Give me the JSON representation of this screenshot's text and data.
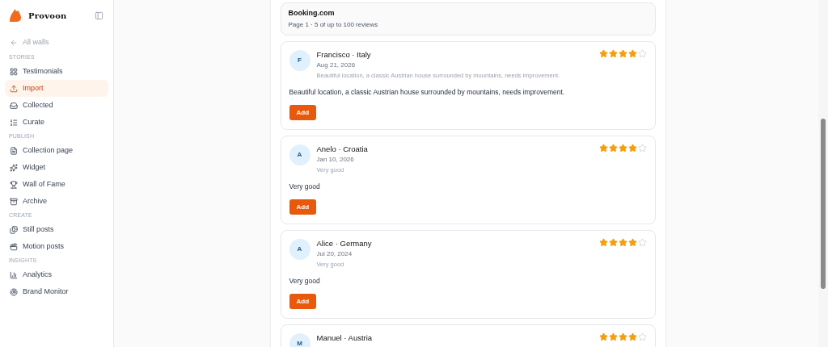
{
  "sidebar": {
    "brand": "Provoon",
    "back_link": "All walls",
    "sections": [
      {
        "title": "STORIES",
        "items": [
          {
            "label": "Testimonials",
            "selected": false
          },
          {
            "label": "Import",
            "selected": true
          },
          {
            "label": "Collected",
            "selected": false
          },
          {
            "label": "Curate",
            "selected": false
          }
        ]
      },
      {
        "title": "PUBLISH",
        "items": [
          {
            "label": "Collection page",
            "selected": false
          },
          {
            "label": "Widget",
            "selected": false
          },
          {
            "label": "Wall of Fame",
            "selected": false
          },
          {
            "label": "Archive",
            "selected": false
          }
        ]
      },
      {
        "title": "CREATE",
        "items": [
          {
            "label": "Still posts",
            "selected": false
          },
          {
            "label": "Motion posts",
            "selected": false
          }
        ]
      },
      {
        "title": "INSIGHTS",
        "items": [
          {
            "label": "Analytics",
            "selected": false
          },
          {
            "label": "Brand Monitor",
            "selected": false
          }
        ]
      }
    ]
  },
  "source": {
    "name": "Booking.com",
    "summary": "Page 1 · 5 of up to 100 reviews"
  },
  "reviews": [
    {
      "initial": "F",
      "author": "Francisco · Italy",
      "date": "Aug 21, 2026",
      "title": "Beautiful location, a classic Austrian house surrounded by mountains, needs improvement.",
      "stars": 4,
      "body": "Beautiful location, a classic Austrian house surrounded by mountains, needs improvement.",
      "button": "Add"
    },
    {
      "initial": "A",
      "author": "Anelo · Croatia",
      "date": "Jan 10, 2026",
      "title": "Very good",
      "stars": 4,
      "body": "Very good",
      "button": "Add"
    },
    {
      "initial": "A",
      "author": "Alice · Germany",
      "date": "Jul 20, 2024",
      "title": "Very good",
      "stars": 4,
      "body": "Very good",
      "button": "Add"
    },
    {
      "initial": "M",
      "author": "Manuel · Austria",
      "stars": 4
    }
  ]
}
